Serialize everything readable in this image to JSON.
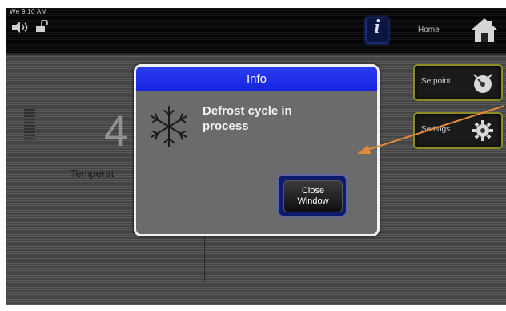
{
  "statusbar": {
    "time": "We 9:10 AM"
  },
  "nav": {
    "info_glyph": "i",
    "home_label": "Home"
  },
  "main": {
    "value_partial": "4",
    "temperature_label": "Temperat"
  },
  "side_buttons": [
    {
      "label": "Setpoint",
      "icon": "setpoint-icon"
    },
    {
      "label": "Settings",
      "icon": "settings-icon"
    }
  ],
  "dialog": {
    "title": "Info",
    "message_line1": "Defrost cycle in",
    "message_line2": "process",
    "close_line1": "Close",
    "close_line2": "Window",
    "icon": "snowflake-icon"
  },
  "colors": {
    "dialog_title_bg": "#1e2ff0",
    "annotation_arrow": "#e08a3a",
    "button_border": "#8c8a25"
  }
}
